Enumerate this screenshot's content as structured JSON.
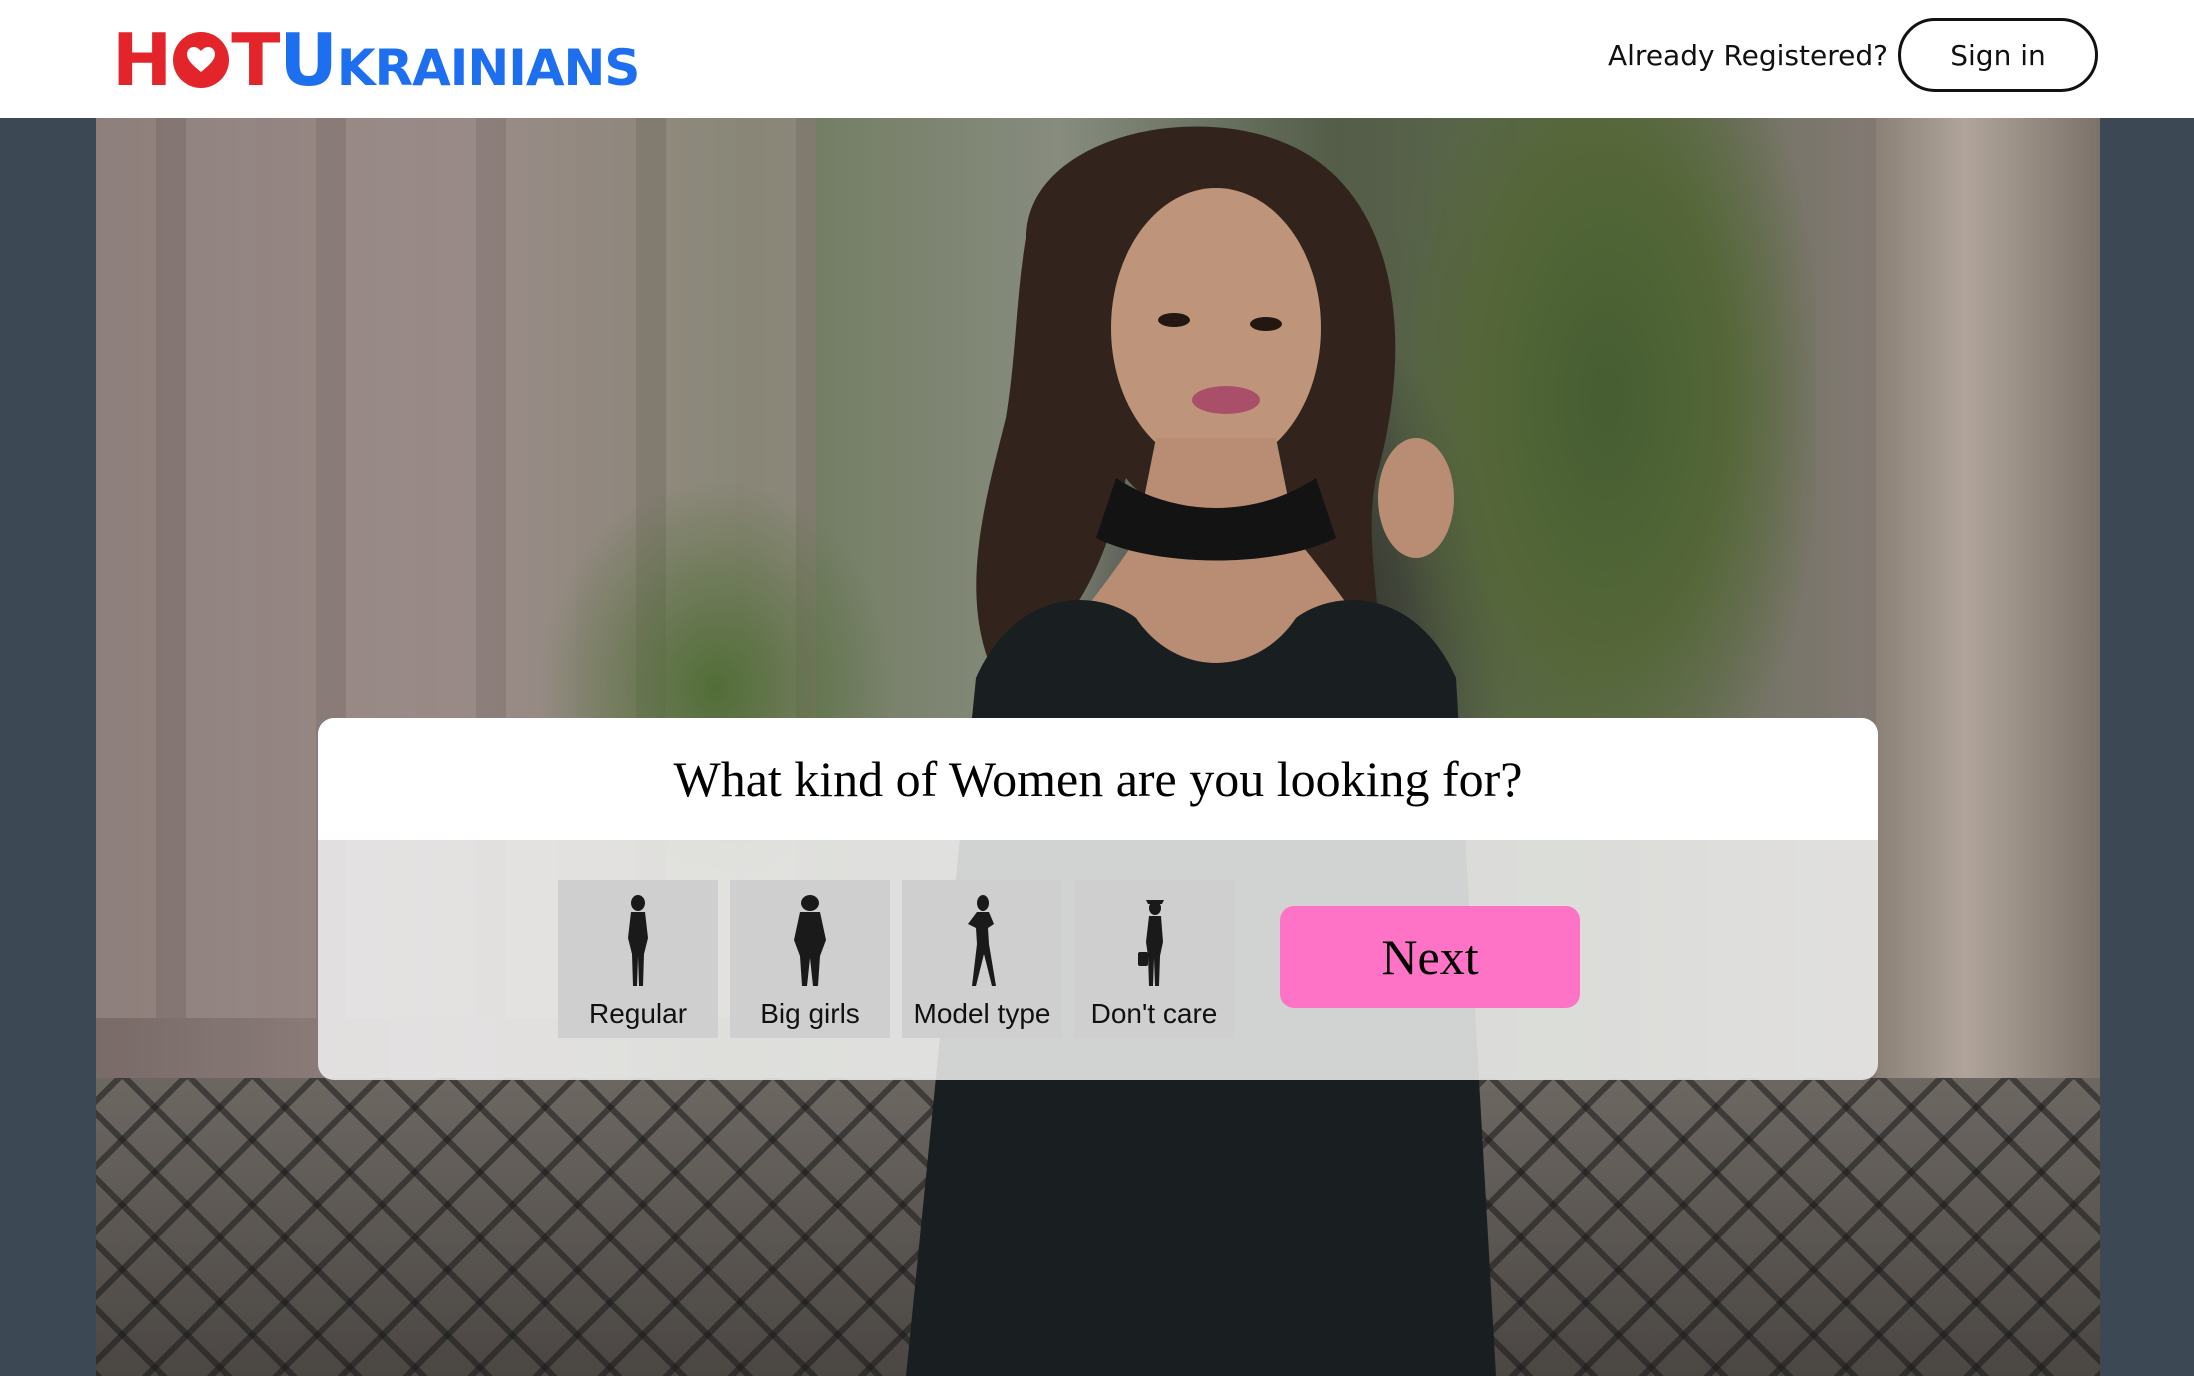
{
  "header": {
    "logo_hot_left": "H",
    "logo_hot_right": "T",
    "logo_brand": "Ukrainians",
    "already_registered": "Already Registered?",
    "signin_label": "Sign in"
  },
  "question": {
    "title": "What kind of Women are you looking for?",
    "options": [
      {
        "label": "Regular",
        "icon": "woman-silhouette-regular-icon"
      },
      {
        "label": "Big girls",
        "icon": "woman-silhouette-big-icon"
      },
      {
        "label": "Model type",
        "icon": "woman-silhouette-model-icon"
      },
      {
        "label": "Don't care",
        "icon": "woman-silhouette-any-icon"
      }
    ],
    "next_label": "Next"
  },
  "colors": {
    "brand_red": "#e3242b",
    "brand_blue": "#1e6ff0",
    "next_button": "#ff73c6",
    "option_tile": "#cfcfcf"
  }
}
